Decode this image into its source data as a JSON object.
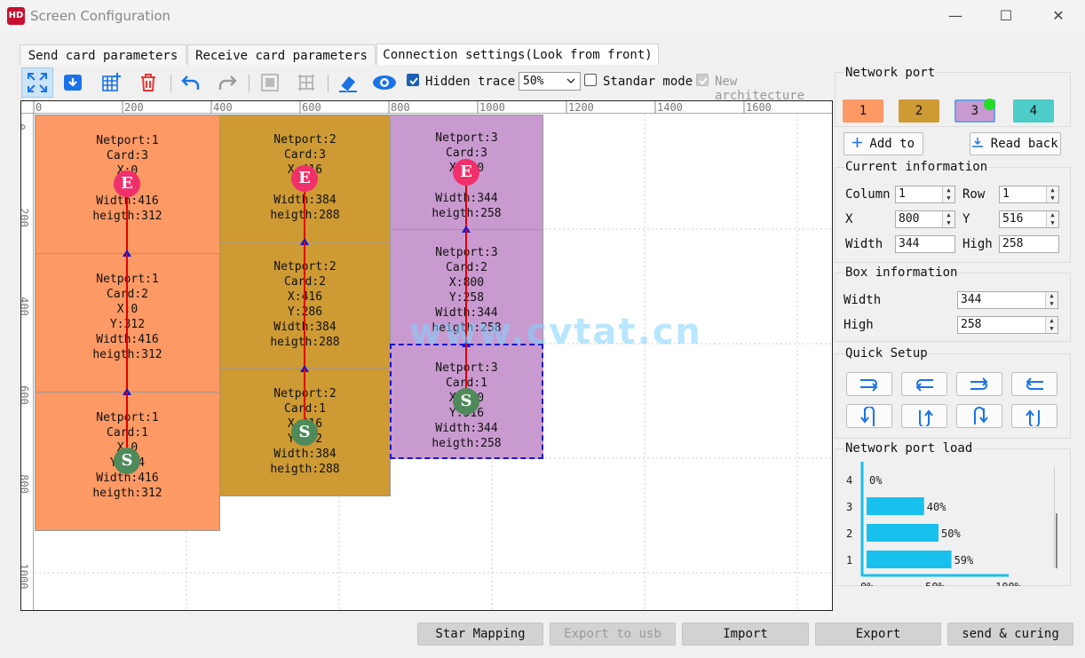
{
  "window": {
    "app_icon_text": "HD",
    "title": "Screen Configuration",
    "min": "—",
    "max": "☐",
    "close": "✕"
  },
  "tabs": [
    {
      "label": "Send card parameters",
      "active": false
    },
    {
      "label": "Receive card parameters",
      "active": false
    },
    {
      "label": "Connection settings(Look from front)",
      "active": true
    }
  ],
  "toolbar": {
    "hidden_trace_label": "Hidden trace",
    "hidden_trace_checked": true,
    "zoom_value": "50%",
    "standard_mode_label": "Standar mode",
    "standard_mode_checked": false,
    "new_arch_label": "New architecture",
    "new_arch_checked": true,
    "new_arch_enabled": false
  },
  "ruler": {
    "top": [
      "0",
      "200",
      "400",
      "600",
      "800",
      "1000",
      "1200",
      "1400",
      "1600"
    ],
    "left": [
      "0",
      "200",
      "400",
      "600",
      "800",
      "1000"
    ]
  },
  "watermark": "www.cvtat.cn",
  "cards": [
    {
      "lines": [
        "Netport:1",
        "Card:3",
        "X:0",
        "",
        "Width:416",
        "heigth:312"
      ],
      "color": "#fc9964",
      "node": "E"
    },
    {
      "lines": [
        "Netport:1",
        "Card:2",
        "X:0",
        "Y:312",
        "Width:416",
        "heigth:312"
      ],
      "color": "#fc9964",
      "node": ""
    },
    {
      "lines": [
        "Netport:1",
        "Card:1",
        "X:0",
        "Y:624",
        "Width:416",
        "heigth:312"
      ],
      "color": "#fc9964",
      "node": "S"
    },
    {
      "lines": [
        "Netport:2",
        "Card:3",
        "X:416",
        "",
        "Width:384",
        "heigth:288"
      ],
      "color": "#cd9a34",
      "node": "E"
    },
    {
      "lines": [
        "Netport:2",
        "Card:2",
        "X:416",
        "Y:286",
        "Width:384",
        "heigth:288"
      ],
      "color": "#cd9a34",
      "node": ""
    },
    {
      "lines": [
        "Netport:2",
        "Card:1",
        "X:416",
        "Y:572",
        "Width:384",
        "heigth:288"
      ],
      "color": "#cd9a34",
      "node": "S"
    },
    {
      "lines": [
        "Netport:3",
        "Card:3",
        "X:800",
        "",
        "Width:344",
        "heigth:258"
      ],
      "color": "#c99acf",
      "node": "E"
    },
    {
      "lines": [
        "Netport:3",
        "Card:2",
        "X:800",
        "Y:258",
        "Width:344",
        "heigth:258"
      ],
      "color": "#c99acf",
      "node": ""
    },
    {
      "lines": [
        "Netport:3",
        "Card:1",
        "X:800",
        "Y:516",
        "Width:344",
        "heigth:258"
      ],
      "color": "#c99acf",
      "node": "S",
      "selected": true
    }
  ],
  "right_panel": {
    "network_port_title": "Network port",
    "ports": [
      {
        "label": "1",
        "color": "#fc9964"
      },
      {
        "label": "2",
        "color": "#cd9a34"
      },
      {
        "label": "3",
        "color": "#c99acf",
        "selected": true
      },
      {
        "label": "4",
        "color": "#4dccc8"
      }
    ],
    "add_to": "Add to",
    "read_back": "Read back",
    "current_info_title": "Current information",
    "column_label": "Column",
    "column_value": "1",
    "row_label": "Row",
    "row_value": "1",
    "x_label": "X",
    "x_value": "800",
    "y_label": "Y",
    "y_value": "516",
    "width_label": "Width",
    "width_value": "344",
    "high_label": "High",
    "high_value": "258",
    "box_info_title": "Box information",
    "box_width_label": "Width",
    "box_width_value": "344",
    "box_high_label": "High",
    "box_high_value": "258",
    "quick_setup_title": "Quick Setup",
    "load_title": "Network port load"
  },
  "chart_data": {
    "type": "bar",
    "orientation": "horizontal",
    "categories": [
      "1",
      "2",
      "3",
      "4"
    ],
    "values": [
      59,
      50,
      40,
      0
    ],
    "value_labels": [
      "59%",
      "50%",
      "40%",
      "0%"
    ],
    "xticks": [
      "0%",
      "50%",
      "100%"
    ],
    "xlim": [
      0,
      100
    ],
    "color": "#18c0ee"
  },
  "bottom_buttons": [
    {
      "label": "Star Mapping",
      "enabled": true
    },
    {
      "label": "Export to usb",
      "enabled": false
    },
    {
      "label": "Import",
      "enabled": true
    },
    {
      "label": "Export",
      "enabled": true
    },
    {
      "label": "send & curing",
      "enabled": true
    }
  ]
}
